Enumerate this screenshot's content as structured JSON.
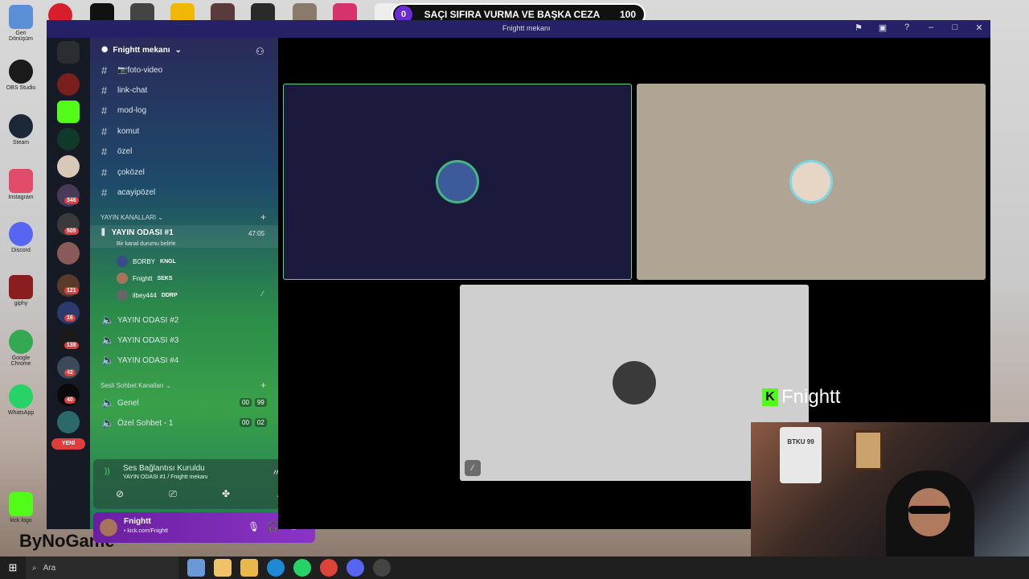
{
  "desktop": {
    "icons": [
      {
        "label": "Geri Dönüşüm",
        "color": "#5a8fd6"
      },
      {
        "label": "OBS Studio",
        "color": "#1b1b1b"
      },
      {
        "label": "Steam",
        "color": "#1b2838"
      },
      {
        "label": "Instagram",
        "color": "#e24b6a"
      },
      {
        "label": "Discord",
        "color": "#5865f2"
      },
      {
        "label": "giphy",
        "color": "#8a1e1e"
      },
      {
        "label": "Google Chrome",
        "color": "#34a853"
      },
      {
        "label": "WhatsApp",
        "color": "#25d366"
      },
      {
        "label": "kick logo",
        "color": "#53fc18"
      }
    ],
    "watermark": "ByNoGame"
  },
  "goal_bar": {
    "left_value": "0",
    "text": "SAÇI SIFIRA VURMA VE BAŞKA CEZA",
    "right_value": "100"
  },
  "window": {
    "title": "Fnightt mekanı"
  },
  "server_badges": [
    "346",
    "505",
    "121",
    "16",
    "138",
    "42",
    "40"
  ],
  "new_label": "YENİ",
  "sidebar": {
    "server_name": "Fnightt mekanı",
    "text_channels": [
      "📷foto-video",
      "link-chat",
      "mod-log",
      "komut",
      "özel",
      "çoközel",
      "acayipözel"
    ],
    "category_streams": "YAYIN KANALLARI",
    "active_voice": {
      "name": "YAYIN ODASI #1",
      "time": "47:05",
      "subtitle": "Bir kanal durumu belirle"
    },
    "members": [
      {
        "name": "BORBY",
        "tag": "KNGL",
        "color": "#3a4a8a"
      },
      {
        "name": "Fnightt",
        "tag": "SEKS",
        "color": "#a5745a"
      },
      {
        "name": "ilbey444",
        "tag": "DDRP",
        "color": "#666666"
      }
    ],
    "other_voice": [
      "YAYIN ODASI #2",
      "YAYIN ODASI #3",
      "YAYIN ODASI #4"
    ],
    "category_voice": "Sesli Sohbet Kanalları",
    "voice_channels": [
      {
        "name": "Genel",
        "a": "00",
        "b": "99"
      },
      {
        "name": "Özel Sohbet - 1",
        "a": "00",
        "b": "02"
      }
    ]
  },
  "voice_panel": {
    "status": "Ses Bağlantısı Kuruldu",
    "location": "YAYIN ODASI #1 / Fnightt mekanı"
  },
  "user_panel": {
    "name": "Fnightt",
    "status": "• kick.com/Fnightt"
  },
  "stage": {
    "tiles": [
      {
        "bg": "#1b1a3d",
        "avatar": "#3d5a9a"
      },
      {
        "bg": "#b0a494",
        "avatar": "#e7d5c6"
      },
      {
        "bg": "#cfcfcf",
        "avatar": "#3a3a3a"
      }
    ]
  },
  "overlay_brand": "Fnightt",
  "webcam": {
    "shirt_text": "BTKU 99"
  },
  "taskbar": {
    "search_placeholder": "Ara"
  }
}
